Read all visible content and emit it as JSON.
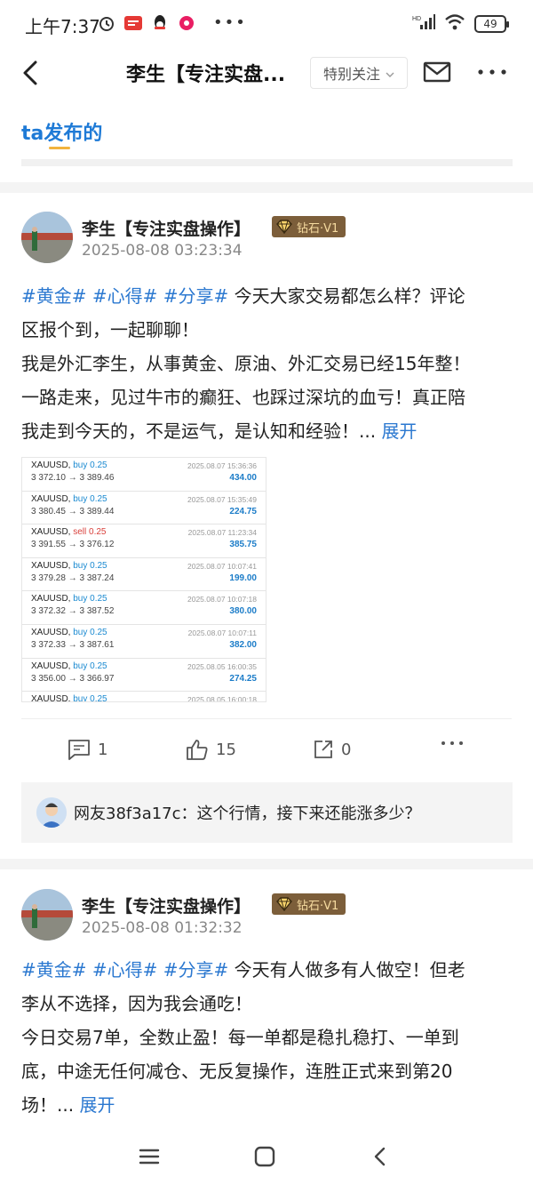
{
  "status_bar": {
    "time": "上午7:37",
    "battery": "49"
  },
  "header": {
    "title": "李生【专注实盘...",
    "follow_label": "特别关注"
  },
  "tab": {
    "label": "ta发布的"
  },
  "posts": [
    {
      "author": "李生【专注实盘操作】",
      "badge": "钻石·V1",
      "time": "2025-08-08 03:23:34",
      "tags": [
        "#黄金#",
        "#心得#",
        "#分享#"
      ],
      "text_lines": [
        "今天大家交易都怎么样？评论",
        "区报个到，一起聊聊！",
        "我是外汇李生，从事黄金、原油、外汇交易已经15年整！",
        "一路走来，见过牛市的癫狂、也踩过深坑的血亏！真正陪",
        "我走到今天的，不是运气，是认知和经验！..."
      ],
      "expand": "展开",
      "trades": [
        {
          "symbol": "XAUUSD,",
          "side": "buy 0.25",
          "side_type": "buy",
          "date": "2025.08.07 15:36:36",
          "prices": "3 372.10 → 3 389.46",
          "profit": "434.00"
        },
        {
          "symbol": "XAUUSD,",
          "side": "buy 0.25",
          "side_type": "buy",
          "date": "2025.08.07 15:35:49",
          "prices": "3 380.45 → 3 389.44",
          "profit": "224.75"
        },
        {
          "symbol": "XAUUSD,",
          "side": "sell 0.25",
          "side_type": "sell",
          "date": "2025.08.07 11:23:34",
          "prices": "3 391.55 → 3 376.12",
          "profit": "385.75"
        },
        {
          "symbol": "XAUUSD,",
          "side": "buy 0.25",
          "side_type": "buy",
          "date": "2025.08.07 10:07:41",
          "prices": "3 379.28 → 3 387.24",
          "profit": "199.00"
        },
        {
          "symbol": "XAUUSD,",
          "side": "buy 0.25",
          "side_type": "buy",
          "date": "2025.08.07 10:07:18",
          "prices": "3 372.32 → 3 387.52",
          "profit": "380.00"
        },
        {
          "symbol": "XAUUSD,",
          "side": "buy 0.25",
          "side_type": "buy",
          "date": "2025.08.07 10:07:11",
          "prices": "3 372.33 → 3 387.61",
          "profit": "382.00"
        },
        {
          "symbol": "XAUUSD,",
          "side": "buy 0.25",
          "side_type": "buy",
          "date": "2025.08.05 16:00:35",
          "prices": "3 356.00 → 3 366.97",
          "profit": "274.25"
        },
        {
          "symbol": "XAUUSD,",
          "side": "buy 0.25",
          "side_type": "buy",
          "date": "2025.08.05 16:00:18",
          "prices": "",
          "profit": ""
        }
      ],
      "comment_count": "1",
      "like_count": "15",
      "share_count": "0",
      "top_comment": "网友38f3a17c：这个行情，接下来还能涨多少？"
    },
    {
      "author": "李生【专注实盘操作】",
      "badge": "钻石·V1",
      "time": "2025-08-08 01:32:32",
      "tags": [
        "#黄金#",
        "#心得#",
        "#分享#"
      ],
      "text_lines": [
        "今天有人做多有人做空！但老",
        "李从不选择，因为我会通吃！",
        "今日交易7单，全数止盈！每一单都是稳扎稳打、一单到",
        "底，中途无任何减仓、无反复操作，连胜正式来到第20",
        "场！..."
      ],
      "expand": "展开"
    }
  ],
  "colors": {
    "accent_blue": "#2b78d0",
    "tab_blue": "#1e7ad6",
    "tab_underline": "#f2b33d",
    "badge_bg": "#7c5e3a",
    "badge_text": "#f6dba0",
    "trade_buy": "#1b8ad1",
    "trade_sell": "#d9413c"
  },
  "icons": [
    "back-arrow-icon",
    "mail-icon",
    "more-icon",
    "comment-icon",
    "like-icon",
    "share-icon",
    "menu-icon",
    "home-icon",
    "back-nav-icon",
    "diamond-icon"
  ]
}
